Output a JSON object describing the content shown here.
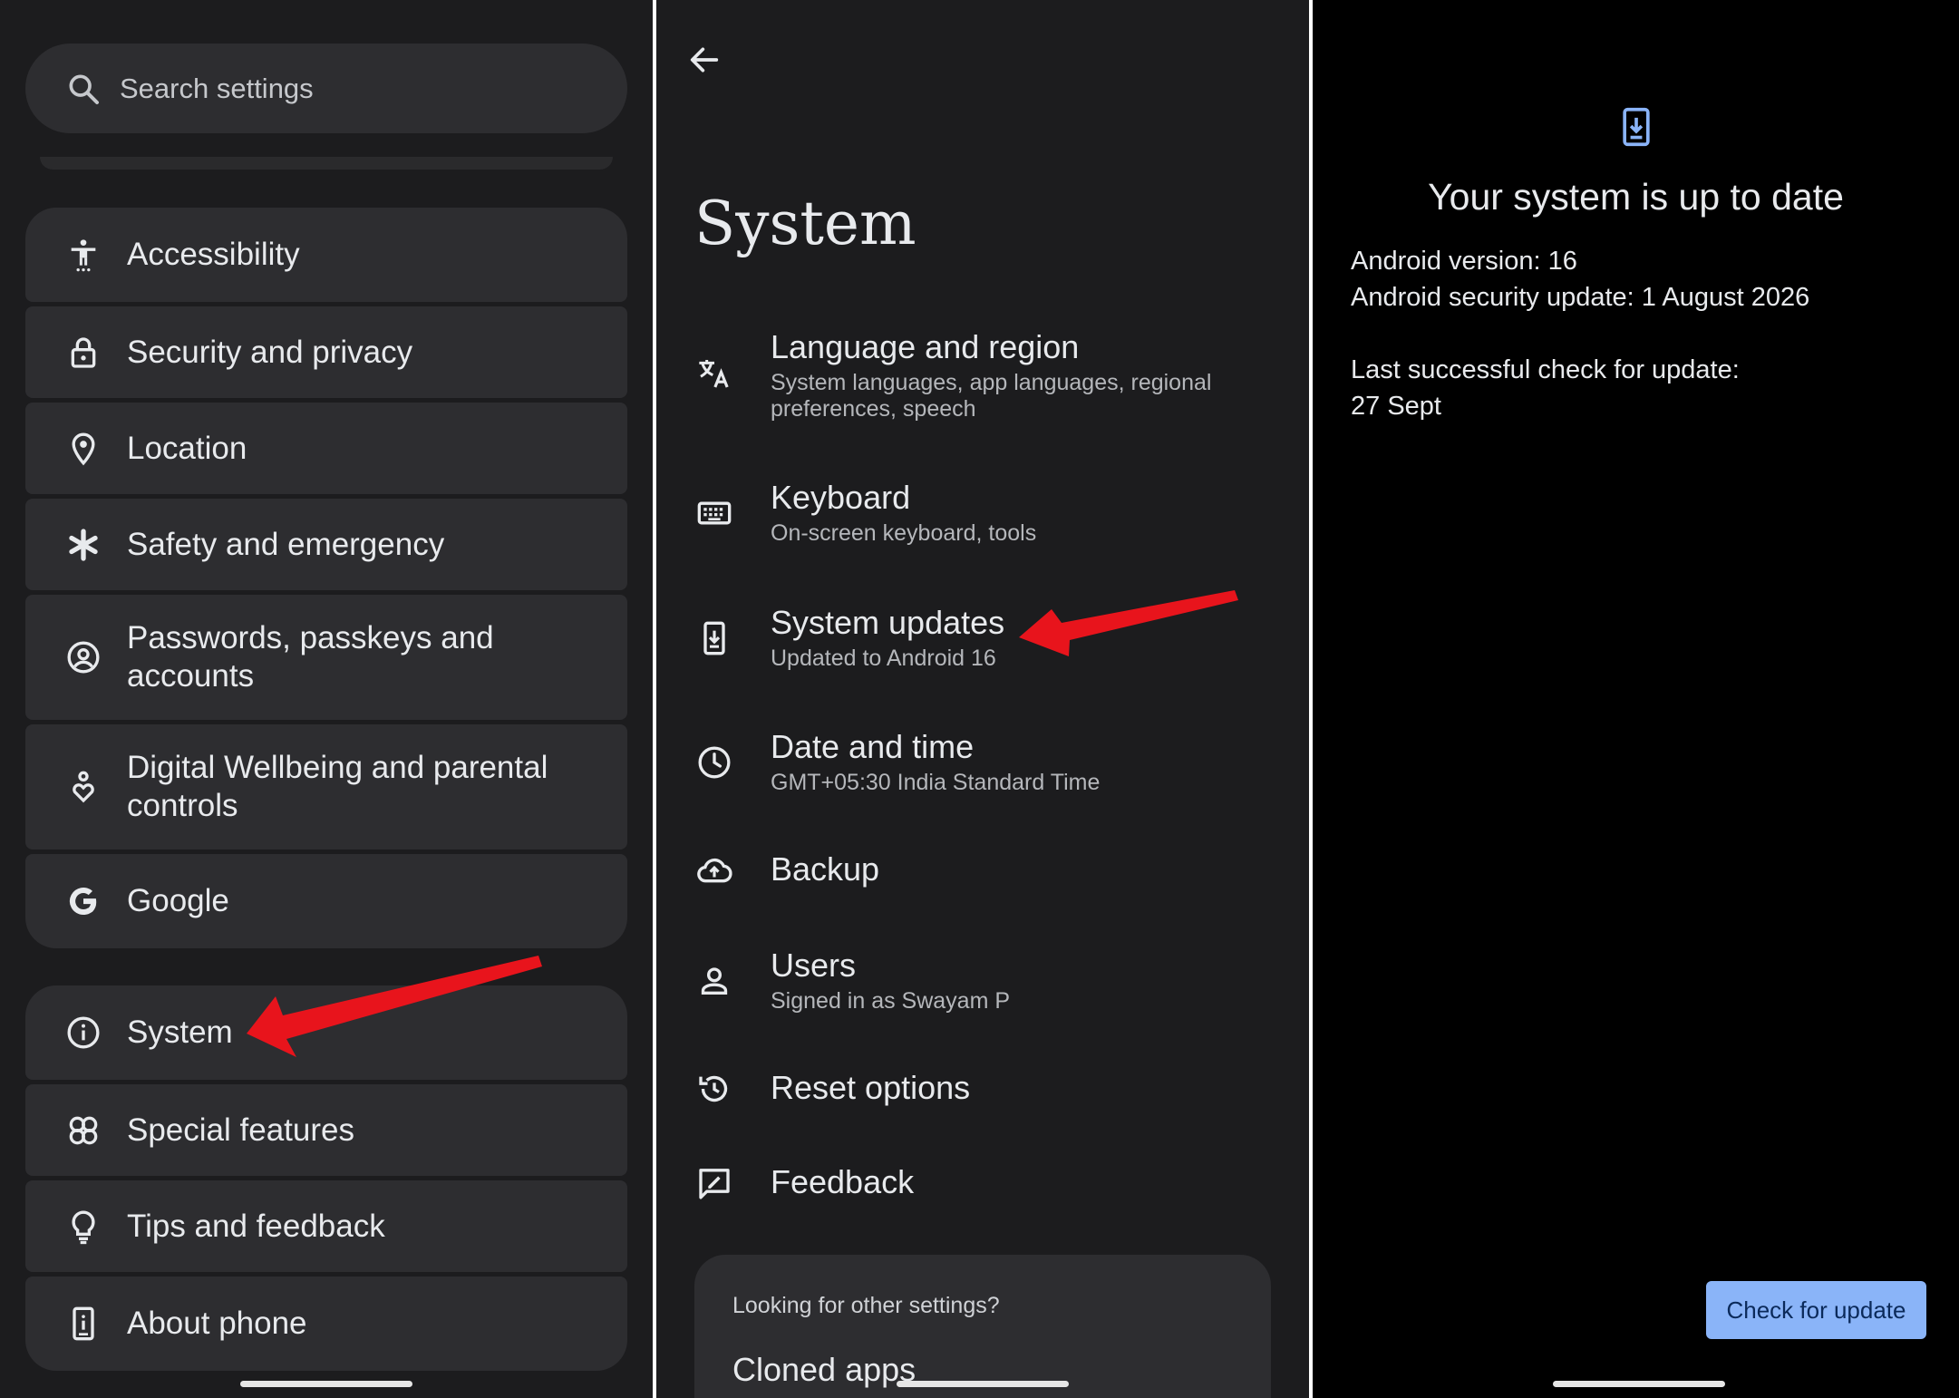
{
  "settings": {
    "search_placeholder": "Search settings",
    "items": [
      {
        "label": "Accessibility",
        "icon": "accessibility-icon"
      },
      {
        "label": "Security and privacy",
        "icon": "lock-icon"
      },
      {
        "label": "Location",
        "icon": "location-pin-icon"
      },
      {
        "label": "Safety and emergency",
        "icon": "asterisk-icon"
      },
      {
        "label": "Passwords, passkeys and accounts",
        "icon": "account-circle-icon"
      },
      {
        "label": "Digital Wellbeing and parental controls",
        "icon": "wellbeing-icon"
      },
      {
        "label": "Google",
        "icon": "google-g-icon"
      },
      {
        "label": "System",
        "icon": "info-icon"
      },
      {
        "label": "Special features",
        "icon": "special-features-icon"
      },
      {
        "label": "Tips and feedback",
        "icon": "lightbulb-icon"
      },
      {
        "label": "About phone",
        "icon": "phone-info-icon"
      }
    ]
  },
  "system": {
    "title": "System",
    "items": [
      {
        "title": "Language and region",
        "subtitle": "System languages, app languages, regional preferences, speech",
        "icon": "translate-icon"
      },
      {
        "title": "Keyboard",
        "subtitle": "On-screen keyboard, tools",
        "icon": "keyboard-icon"
      },
      {
        "title": "System updates",
        "subtitle": "Updated to Android 16",
        "icon": "system-update-icon"
      },
      {
        "title": "Date and time",
        "subtitle": "GMT+05:30 India Standard Time",
        "icon": "clock-icon"
      },
      {
        "title": "Backup",
        "icon": "cloud-upload-icon"
      },
      {
        "title": "Users",
        "subtitle": "Signed in as Swayam P",
        "icon": "person-icon"
      },
      {
        "title": "Reset options",
        "icon": "history-icon"
      },
      {
        "title": "Feedback",
        "icon": "feedback-icon"
      }
    ],
    "other_settings": {
      "question": "Looking for other settings?",
      "first_item": "Cloned apps"
    }
  },
  "update": {
    "title": "Your system is up to date",
    "android_version": "Android version: 16",
    "security_update": "Android security update: 1 August 2026",
    "last_check_label": "Last successful check for update:",
    "last_check_date": "27 Sept",
    "check_button": "Check for update"
  },
  "colors": {
    "panel_bg": "#1c1c1e",
    "card_bg": "#2d2d30",
    "accent_blue": "#8ab4f8",
    "annotation_arrow": "#e8141c"
  }
}
